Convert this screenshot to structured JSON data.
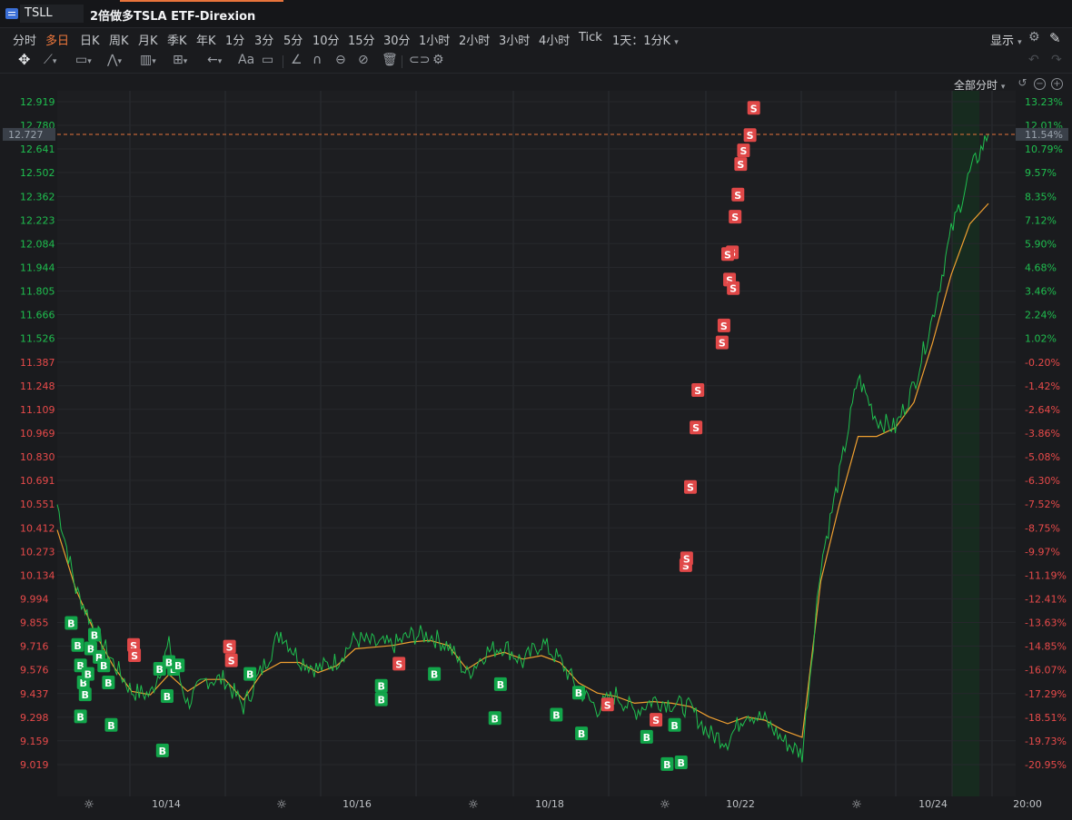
{
  "window": {
    "symbol": "TSLL",
    "name": "2倍做多TSLA ETF-Direxion"
  },
  "periods": [
    {
      "label": "分时",
      "active": false
    },
    {
      "label": "多日",
      "active": true
    },
    {
      "label": "日K",
      "active": false
    },
    {
      "label": "周K",
      "active": false
    },
    {
      "label": "月K",
      "active": false
    },
    {
      "label": "季K",
      "active": false
    },
    {
      "label": "年K",
      "active": false
    },
    {
      "label": "1分",
      "active": false
    },
    {
      "label": "3分",
      "active": false
    },
    {
      "label": "5分",
      "active": false
    },
    {
      "label": "10分",
      "active": false
    },
    {
      "label": "15分",
      "active": false
    },
    {
      "label": "30分",
      "active": false
    },
    {
      "label": "1小时",
      "active": false
    },
    {
      "label": "2小时",
      "active": false
    },
    {
      "label": "3小时",
      "active": false
    },
    {
      "label": "4小时",
      "active": false
    },
    {
      "label": "Tick",
      "active": false
    },
    {
      "label": "1天：1分K",
      "active": false
    }
  ],
  "display_label": "显示",
  "all_minutes_label": "全部分时",
  "colors": {
    "up": "#1fbf4f",
    "down": "#e84a4a",
    "avg_line": "#f0a030",
    "current_line": "#e8743b",
    "buy_marker": "#12a54a",
    "sell_marker": "#e04848"
  },
  "chart_data": {
    "type": "line",
    "title": "",
    "current_price": "12.727",
    "current_pct": "11.54%",
    "ylim": [
      9.0,
      12.919
    ],
    "price_ticks": [
      "12.919",
      "12.780",
      "12.641",
      "12.502",
      "12.362",
      "12.223",
      "12.084",
      "11.944",
      "11.805",
      "11.666",
      "11.526",
      "11.387",
      "11.248",
      "11.109",
      "10.969",
      "10.830",
      "10.691",
      "10.551",
      "10.412",
      "10.273",
      "10.134",
      "9.994",
      "9.855",
      "9.716",
      "9.576",
      "9.437",
      "9.298",
      "9.159",
      "9.019"
    ],
    "pct_ticks": [
      "13.23%",
      "12.01%",
      "10.79%",
      "9.57%",
      "8.35%",
      "7.12%",
      "5.90%",
      "4.68%",
      "3.46%",
      "2.24%",
      "1.02%",
      "-0.20%",
      "-1.42%",
      "-2.64%",
      "-3.86%",
      "-5.08%",
      "-6.30%",
      "-7.52%",
      "-8.75%",
      "-9.97%",
      "-11.19%",
      "-12.41%",
      "-13.63%",
      "-14.85%",
      "-16.07%",
      "-17.29%",
      "-18.51%",
      "-19.73%",
      "-20.95%"
    ],
    "x_tick_labels": [
      "10/14",
      "10/16",
      "10/18",
      "10/22",
      "10/24",
      "20:00"
    ],
    "price_series": {
      "name": "",
      "x": [
        0,
        2,
        4,
        6,
        8,
        10,
        12,
        14,
        16,
        18,
        20,
        22,
        24,
        26,
        28,
        30,
        32,
        34,
        36,
        38,
        40,
        42,
        44,
        46,
        48,
        50,
        52,
        54,
        56,
        58,
        60,
        62,
        64,
        66,
        68,
        70,
        72,
        74,
        76,
        78,
        80,
        82,
        84,
        86,
        88,
        90,
        92,
        94,
        96,
        98,
        100
      ],
      "values": [
        10.55,
        10.05,
        9.82,
        9.62,
        9.45,
        9.43,
        9.72,
        9.38,
        9.52,
        9.52,
        9.36,
        9.58,
        9.8,
        9.64,
        9.58,
        9.63,
        9.76,
        9.73,
        9.72,
        9.78,
        9.78,
        9.72,
        9.55,
        9.68,
        9.72,
        9.62,
        9.74,
        9.63,
        9.46,
        9.35,
        9.43,
        9.33,
        9.4,
        9.38,
        9.35,
        9.2,
        9.16,
        9.33,
        9.28,
        9.16,
        9.08,
        10.2,
        10.72,
        11.3,
        11.05,
        11.0,
        11.25,
        11.65,
        12.15,
        12.5,
        12.73
      ]
    },
    "avg_series": {
      "name": "",
      "x": [
        0,
        2,
        4,
        6,
        8,
        10,
        12,
        14,
        16,
        18,
        20,
        22,
        24,
        26,
        28,
        30,
        32,
        34,
        36,
        38,
        40,
        42,
        44,
        46,
        48,
        50,
        52,
        54,
        56,
        58,
        60,
        62,
        64,
        66,
        68,
        70,
        72,
        74,
        76,
        78,
        80,
        82,
        84,
        86,
        88,
        90,
        92,
        94,
        96,
        98,
        100
      ],
      "values": [
        10.4,
        10.05,
        9.8,
        9.6,
        9.45,
        9.43,
        9.55,
        9.45,
        9.52,
        9.52,
        9.4,
        9.56,
        9.62,
        9.62,
        9.56,
        9.6,
        9.7,
        9.71,
        9.72,
        9.74,
        9.75,
        9.72,
        9.58,
        9.65,
        9.68,
        9.64,
        9.66,
        9.62,
        9.5,
        9.44,
        9.42,
        9.38,
        9.39,
        9.38,
        9.36,
        9.3,
        9.26,
        9.3,
        9.28,
        9.22,
        9.18,
        10.1,
        10.55,
        10.95,
        10.95,
        11.0,
        11.15,
        11.5,
        11.9,
        12.2,
        12.32
      ]
    },
    "buy_markers": [
      {
        "x": 1.5,
        "y": 9.85
      },
      {
        "x": 2.2,
        "y": 9.72
      },
      {
        "x": 2.5,
        "y": 9.6
      },
      {
        "x": 2.8,
        "y": 9.5
      },
      {
        "x": 3.0,
        "y": 9.43
      },
      {
        "x": 3.3,
        "y": 9.55
      },
      {
        "x": 3.6,
        "y": 9.7
      },
      {
        "x": 4.0,
        "y": 9.78
      },
      {
        "x": 4.5,
        "y": 9.65
      },
      {
        "x": 5.0,
        "y": 9.6
      },
      {
        "x": 5.5,
        "y": 9.5
      },
      {
        "x": 2.5,
        "y": 9.3
      },
      {
        "x": 5.8,
        "y": 9.25
      },
      {
        "x": 11.0,
        "y": 9.58
      },
      {
        "x": 12.5,
        "y": 9.58
      },
      {
        "x": 12.0,
        "y": 9.62
      },
      {
        "x": 13.0,
        "y": 9.6
      },
      {
        "x": 11.8,
        "y": 9.42
      },
      {
        "x": 11.3,
        "y": 9.1
      },
      {
        "x": 20.7,
        "y": 9.55
      },
      {
        "x": 34.8,
        "y": 9.4
      },
      {
        "x": 34.8,
        "y": 9.48
      },
      {
        "x": 40.5,
        "y": 9.55
      },
      {
        "x": 47.0,
        "y": 9.29
      },
      {
        "x": 47.6,
        "y": 9.49
      },
      {
        "x": 53.6,
        "y": 9.31
      },
      {
        "x": 56.0,
        "y": 9.44
      },
      {
        "x": 56.3,
        "y": 9.2
      },
      {
        "x": 63.3,
        "y": 9.18
      },
      {
        "x": 66.3,
        "y": 9.25
      },
      {
        "x": 65.5,
        "y": 9.02
      },
      {
        "x": 67.0,
        "y": 9.03
      }
    ],
    "sell_markers": [
      {
        "x": 8.2,
        "y": 9.72
      },
      {
        "x": 8.3,
        "y": 9.66
      },
      {
        "x": 18.5,
        "y": 9.71
      },
      {
        "x": 18.7,
        "y": 9.63
      },
      {
        "x": 36.7,
        "y": 9.61
      },
      {
        "x": 59.1,
        "y": 9.37
      },
      {
        "x": 64.3,
        "y": 9.28
      },
      {
        "x": 67.5,
        "y": 10.19
      },
      {
        "x": 67.6,
        "y": 10.23
      },
      {
        "x": 68.0,
        "y": 10.65
      },
      {
        "x": 68.6,
        "y": 11.0
      },
      {
        "x": 68.8,
        "y": 11.22
      },
      {
        "x": 71.4,
        "y": 11.5
      },
      {
        "x": 71.6,
        "y": 11.6
      },
      {
        "x": 72.2,
        "y": 11.87
      },
      {
        "x": 72.5,
        "y": 12.03
      },
      {
        "x": 72.8,
        "y": 12.24
      },
      {
        "x": 73.1,
        "y": 12.37
      },
      {
        "x": 73.4,
        "y": 12.55
      },
      {
        "x": 73.7,
        "y": 12.63
      },
      {
        "x": 74.4,
        "y": 12.72
      },
      {
        "x": 74.8,
        "y": 12.88
      },
      {
        "x": 72.0,
        "y": 12.02
      },
      {
        "x": 72.6,
        "y": 11.82
      }
    ]
  }
}
